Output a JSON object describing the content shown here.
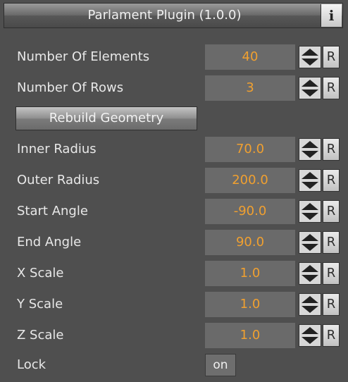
{
  "panel": {
    "title": "Parlament Plugin (1.0.0)",
    "info_label": "i"
  },
  "rebuild_label": "Rebuild Geometry",
  "reset_label": "R",
  "accent_color": "#f0a030",
  "fields": {
    "number_of_elements": {
      "label": "Number Of Elements",
      "value": "40"
    },
    "number_of_rows": {
      "label": "Number Of Rows",
      "value": "3"
    },
    "inner_radius": {
      "label": "Inner Radius",
      "value": "70.0"
    },
    "outer_radius": {
      "label": "Outer Radius",
      "value": "200.0"
    },
    "start_angle": {
      "label": "Start Angle",
      "value": "-90.0"
    },
    "end_angle": {
      "label": "End Angle",
      "value": "90.0"
    },
    "x_scale": {
      "label": "X Scale",
      "value": "1.0"
    },
    "y_scale": {
      "label": "Y Scale",
      "value": "1.0"
    },
    "z_scale": {
      "label": "Z Scale",
      "value": "1.0"
    }
  },
  "lock": {
    "label": "Lock",
    "state": "on"
  },
  "icons": {
    "spinner": "up-down-arrows-icon",
    "info": "info-icon"
  }
}
